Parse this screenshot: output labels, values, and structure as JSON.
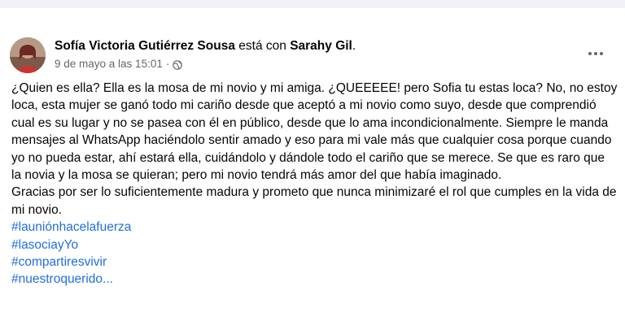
{
  "post": {
    "author": "Sofía Victoria Gutiérrez Sousa",
    "with_text": "está con",
    "tagged": "Sarahy Gil",
    "tagged_suffix": ".",
    "timestamp": "9 de mayo a las 15:01",
    "separator": "·",
    "privacy_icon": "globe-icon",
    "more_icon": "more-horizontal-icon",
    "paragraph_1": "¿Quien es ella? Ella es la mosa de mi novio y mi amiga. ¿QUEEEEE! pero Sofia tu estas loca? No, no estoy loca, esta mujer se ganó todo mi cariño desde que aceptó a mi novio como suyo, desde que comprendió cual es su lugar y no se pasea con él en público, desde que lo ama incondicionalmente. Siempre le manda mensajes al WhatsApp haciéndolo sentir amado y eso para mi vale más que cualquier cosa porque cuando yo no pueda estar, ahí estará ella, cuidándolo y dándole todo el cariño que se merece. Se que es raro que la novia y la mosa se quieran; pero mi novio tendrá más amor del que había imaginado.",
    "paragraph_2": "Gracias por ser lo suficientemente madura y prometo que nunca minimizaré el rol que cumples en la vida de mi novio.",
    "hashtags": [
      "#launiónhacelafuerza",
      "#lasociayYo",
      "#compartiresvivir",
      "#nuestroquerido..."
    ]
  }
}
